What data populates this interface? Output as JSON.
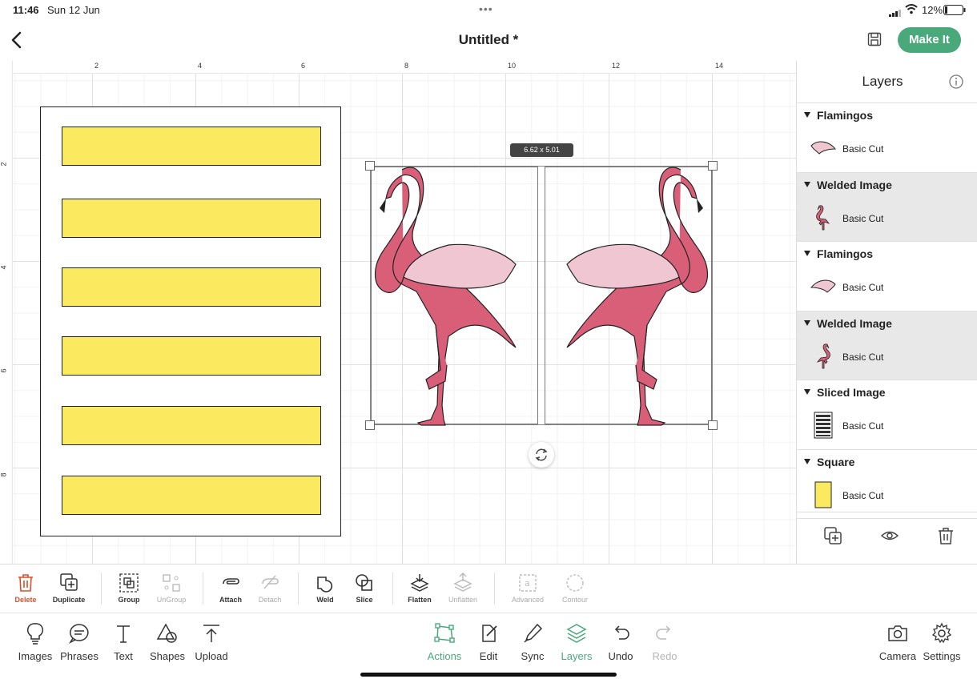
{
  "status": {
    "time": "11:46",
    "date": "Sun 12 Jun",
    "battery": "12%"
  },
  "header": {
    "title": "Untitled *",
    "make_it": "Make It"
  },
  "ruler": {
    "top_ticks": [
      "2",
      "4",
      "6",
      "8",
      "10",
      "12",
      "14"
    ],
    "left_ticks": [
      "2",
      "4",
      "6",
      "8"
    ]
  },
  "canvas": {
    "dimension": "6.62 x 5.01"
  },
  "layers": {
    "title": "Layers",
    "groups": [
      {
        "name": "Flamingos",
        "item": "Basic Cut",
        "thumb": "wing",
        "selected": false
      },
      {
        "name": "Welded Image",
        "item": "Basic Cut",
        "thumb": "flamingo",
        "selected": true
      },
      {
        "name": "Flamingos",
        "item": "Basic Cut",
        "thumb": "wing",
        "selected": false
      },
      {
        "name": "Welded Image",
        "item": "Basic Cut",
        "thumb": "flamingo",
        "selected": true
      },
      {
        "name": "Sliced Image",
        "item": "Basic Cut",
        "thumb": "sliced",
        "selected": false
      },
      {
        "name": "Square",
        "item": "Basic Cut",
        "thumb": "square",
        "selected": false
      }
    ]
  },
  "actions": {
    "delete": "Delete",
    "duplicate": "Duplicate",
    "group": "Group",
    "ungroup": "UnGroup",
    "attach": "Attach",
    "detach": "Detach",
    "weld": "Weld",
    "slice": "Slice",
    "flatten": "Flatten",
    "unflatten": "Unflatten",
    "advanced": "Advanced",
    "contour": "Contour"
  },
  "tabs": {
    "images": "Images",
    "phrases": "Phrases",
    "text": "Text",
    "shapes": "Shapes",
    "upload": "Upload",
    "actions": "Actions",
    "edit": "Edit",
    "sync": "Sync",
    "layers": "Layers",
    "undo": "Undo",
    "redo": "Redo",
    "camera": "Camera",
    "settings": "Settings"
  },
  "colors": {
    "accent": "#4aa97a",
    "flamingo": "#d95f78",
    "wing": "#f0c6d3",
    "yellow": "#fbea60",
    "delete": "#d9502a"
  }
}
